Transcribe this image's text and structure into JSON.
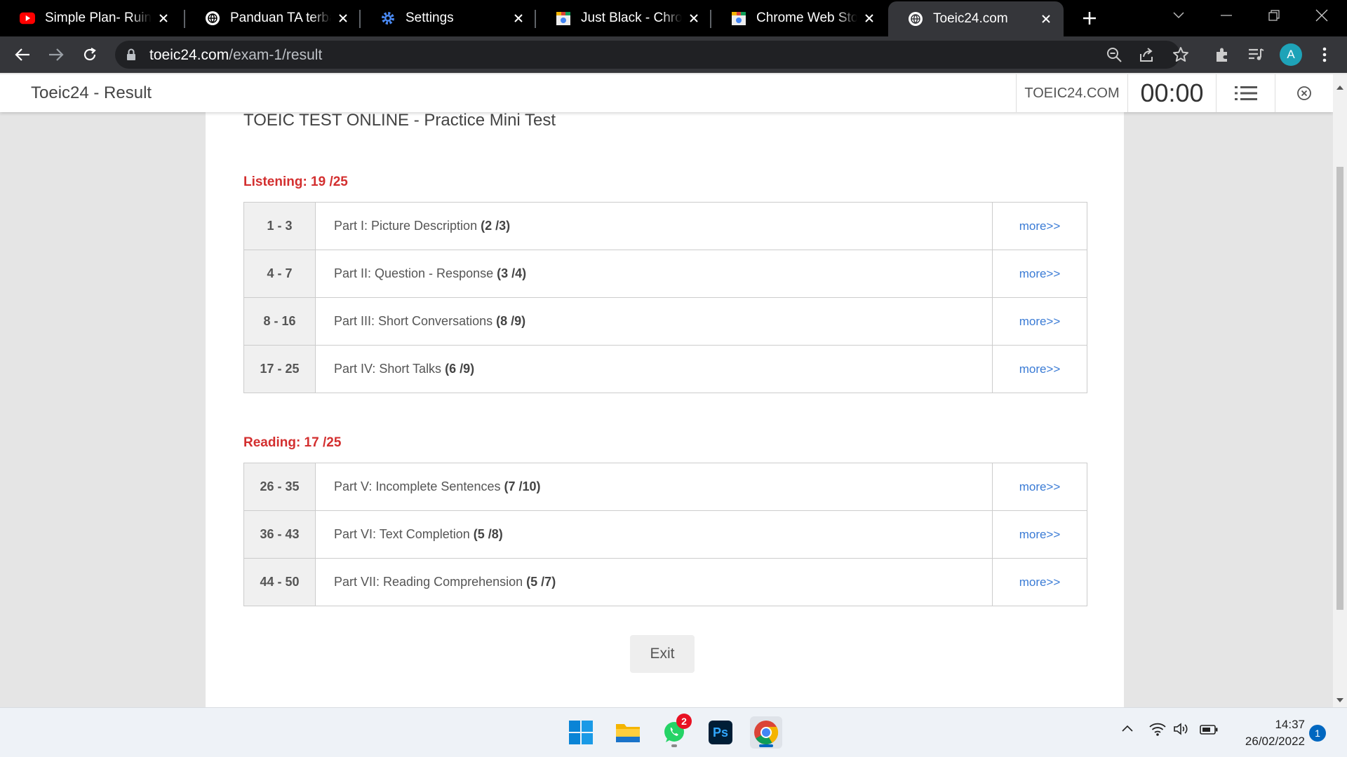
{
  "browser": {
    "tabs": [
      {
        "title": "Simple Plan- Ruin My Life",
        "icon": "youtube-icon"
      },
      {
        "title": "Panduan TA terbaru",
        "icon": "globe-icon"
      },
      {
        "title": "Settings",
        "icon": "gear-icon"
      },
      {
        "title": "Just Black - Chrome Web Store",
        "icon": "web-store-icon"
      },
      {
        "title": "Chrome Web Store",
        "icon": "web-store-icon"
      },
      {
        "title": "Toeic24.com",
        "icon": "globe-icon",
        "active": true
      }
    ],
    "url_host": "toeic24.com",
    "url_path": "/exam-1/result",
    "profile_initial": "A"
  },
  "header": {
    "page_title": "Toeic24 - Result",
    "brand": "TOEIC24.COM",
    "timer": "00:00"
  },
  "test_title": "TOEIC TEST ONLINE - Practice Mini Test",
  "sections": [
    {
      "title": "Listening: 19 /25",
      "rows": [
        {
          "range": "1 - 3",
          "part": "Part I: Picture Description",
          "score": "(2 /3)",
          "link": "more>>"
        },
        {
          "range": "4 - 7",
          "part": "Part II: Question - Response",
          "score": "(3 /4)",
          "link": "more>>"
        },
        {
          "range": "8 - 16",
          "part": "Part III: Short Conversations",
          "score": "(8 /9)",
          "link": "more>>"
        },
        {
          "range": "17 - 25",
          "part": "Part IV: Short Talks",
          "score": "(6 /9)",
          "link": "more>>"
        }
      ]
    },
    {
      "title": "Reading: 17 /25",
      "rows": [
        {
          "range": "26 - 35",
          "part": "Part V: Incomplete Sentences",
          "score": "(7 /10)",
          "link": "more>>"
        },
        {
          "range": "36 - 43",
          "part": "Part VI: Text Completion",
          "score": "(5 /8)",
          "link": "more>>"
        },
        {
          "range": "44 - 50",
          "part": "Part VII: Reading Comprehension",
          "score": "(5 /7)",
          "link": "more>>"
        }
      ]
    }
  ],
  "exit_label": "Exit",
  "taskbar": {
    "whatsapp_badge": "2",
    "photoshop_label": "Ps",
    "time": "14:37",
    "date": "26/02/2022",
    "notifications": "1"
  },
  "colors": {
    "section_title": "#d32f2f",
    "link": "#3a7bd5",
    "profile": "#1ea3b8"
  }
}
